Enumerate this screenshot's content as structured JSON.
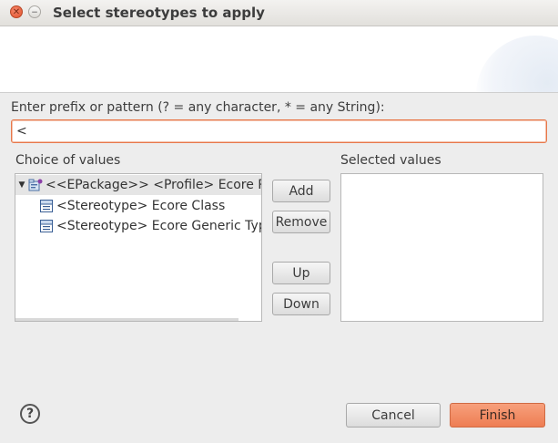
{
  "window": {
    "title": "Select stereotypes to apply",
    "close_glyph": "✕",
    "minimize_glyph": "−"
  },
  "filter": {
    "prompt": "Enter prefix or pattern (? = any character, * = any String):",
    "value": "<"
  },
  "choices": {
    "label": "Choice of values",
    "items": [
      {
        "label": "<<EPackage>> <Profile> Ecore Profi",
        "icon": "package-profile-icon",
        "expanded": true
      },
      {
        "label": "<Stereotype> Ecore Class",
        "icon": "stereotype-icon"
      },
      {
        "label": "<Stereotype> Ecore Generic Type",
        "icon": "stereotype-icon"
      }
    ],
    "expander_glyph": "▼"
  },
  "selected": {
    "label": "Selected values"
  },
  "buttons": {
    "add": "Add",
    "remove": "Remove",
    "up": "Up",
    "down": "Down",
    "cancel": "Cancel",
    "finish": "Finish",
    "help": "?"
  },
  "colors": {
    "accent": "#ee7d53",
    "focus_border": "#e8784a",
    "tree_selection": "#e5e5e5"
  }
}
